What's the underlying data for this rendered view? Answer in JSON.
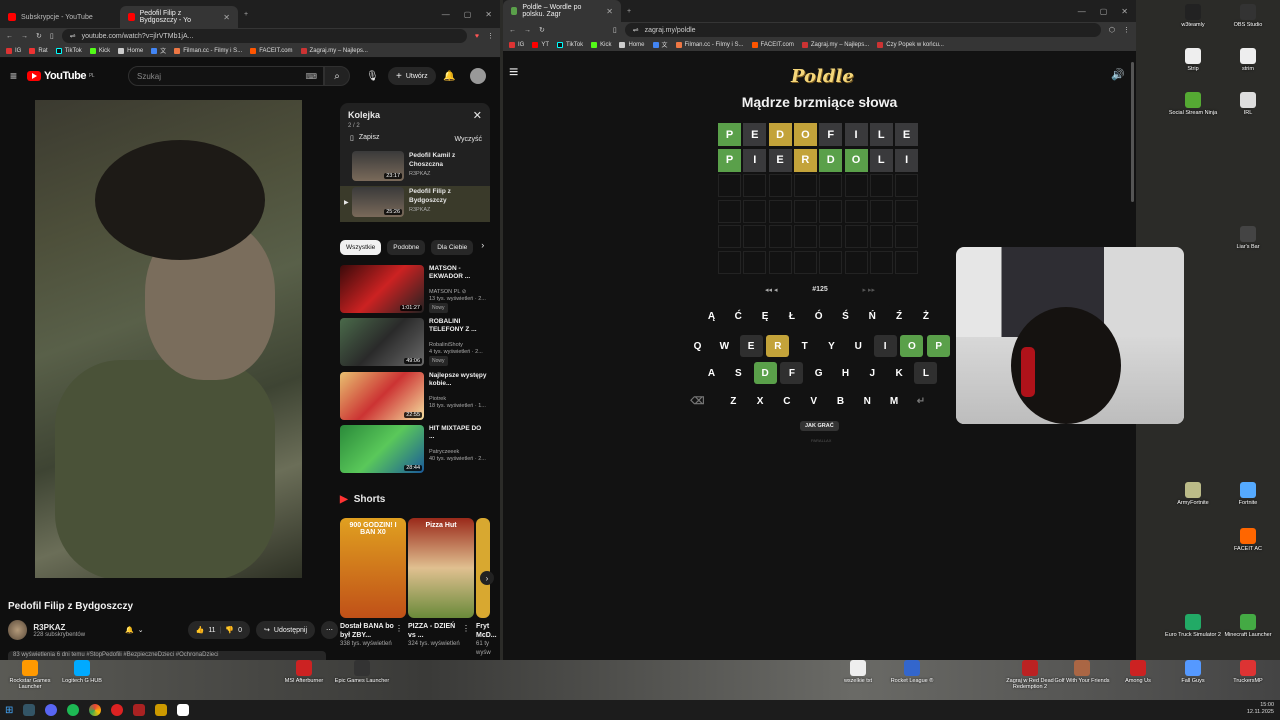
{
  "browser1": {
    "tabs": [
      {
        "label": "Subskrypcje - YouTube"
      },
      {
        "label": "Pedofil Filip z Bydgoszczy - Yo"
      }
    ],
    "url": "youtube.com/watch?v=jlrVTMb1jA...",
    "bookmarks": [
      "IG",
      "Rat",
      "TikTok",
      "Kick",
      "Home",
      "文",
      "Filman.cc - Filmy i S...",
      "FACEIT.com",
      "Zagraj.my – Najleps..."
    ]
  },
  "youtube": {
    "logo": "YouTube",
    "region": "PL",
    "search_placeholder": "Szukaj",
    "create_label": "Utwórz",
    "video_title": "Pedofil Filip z Bydgoszczy",
    "channel": "R3PKAZ",
    "subs": "228 subskrybentów",
    "likes": "11",
    "dislikes": "0",
    "share": "Udostępnij",
    "desc": "83 wyświetlenia  6 dni temu  #StopPedofili #BezpieczneDzieci #OchronaDzieci",
    "queue": {
      "title": "Kolejka",
      "count": "2 / 2",
      "save": "Zapisz",
      "clear": "Wyczyść",
      "items": [
        {
          "title": "Pedofil Kamil z Choszczna",
          "channel": "R3PKAZ",
          "dur": "23:17"
        },
        {
          "title": "Pedofil Filip z Bydgoszczy",
          "channel": "R3PKAZ",
          "dur": "25:26"
        }
      ]
    },
    "chips": [
      "Wszystkie",
      "Podobne",
      "Dla Ciebie"
    ],
    "recs": [
      {
        "t": "MATSON - EKWADOR ...",
        "c": "MATSON PL ⊘",
        "v": "13 tys. wyświetleń · 2...",
        "dur": "1:01:27",
        "badge": "Nowy"
      },
      {
        "t": "ROBALINI TELEFONY Z ...",
        "c": "RobaliniShoty",
        "v": "4 tys. wyświetleń · 2...",
        "dur": "49:06",
        "badge": "Nowy"
      },
      {
        "t": "Najlepsze występy kobie...",
        "c": "Piotrek",
        "v": "18 tys. wyświetleń · 1...",
        "dur": "22:55",
        "badge": ""
      },
      {
        "t": "HIT MIXTAPE DO ...",
        "c": "Patryczeeek",
        "v": "40 tys. wyświetleń · 2...",
        "dur": "28:44",
        "badge": ""
      }
    ],
    "shorts_title": "Shorts",
    "shorts": [
      {
        "t": "Dostał BANA bo był ZBY...",
        "v": "338 tys. wyświetleń",
        "thumb": "900 GODZIN! I BAN X0"
      },
      {
        "t": "PIZZA - DZIEŃ vs ...",
        "v": "324 tys. wyświetleń",
        "thumb": "Pizza Hut"
      },
      {
        "t": "Fryt McD...",
        "v": "61 ty wyśw",
        "thumb": ""
      }
    ]
  },
  "browser2": {
    "tab": "Poldle – Wordle po polsku. Zagr",
    "url": "zagraj.my/poldle",
    "bookmarks": [
      "IG",
      "YT",
      "TikTok",
      "Kick",
      "Home",
      "文",
      "Filman.cc - Filmy i S...",
      "FACEIT.com",
      "Zagraj.my – Najleps...",
      "Czy Popek w końcu..."
    ]
  },
  "poldle": {
    "logo": "Poldle",
    "subtitle": "Mądrze brzmiące słowa",
    "puzzle": "#125",
    "how_to": "JAK GRAĆ",
    "footer": "PARALLAX",
    "rows": [
      [
        {
          "l": "P",
          "s": "g"
        },
        {
          "l": "E",
          "s": "n"
        },
        {
          "l": "D",
          "s": "y"
        },
        {
          "l": "O",
          "s": "y"
        },
        {
          "l": "F",
          "s": "n"
        },
        {
          "l": "I",
          "s": "n"
        },
        {
          "l": "L",
          "s": "n"
        },
        {
          "l": "E",
          "s": "n"
        }
      ],
      [
        {
          "l": "P",
          "s": "g"
        },
        {
          "l": "I",
          "s": "n"
        },
        {
          "l": "E",
          "s": "n"
        },
        {
          "l": "R",
          "s": "y"
        },
        {
          "l": "D",
          "s": "g"
        },
        {
          "l": "O",
          "s": "g"
        },
        {
          "l": "L",
          "s": "n"
        },
        {
          "l": "I",
          "s": "n"
        }
      ]
    ],
    "keys": [
      [
        {
          "k": "Ą",
          "s": ""
        },
        {
          "k": "Ć",
          "s": ""
        },
        {
          "k": "Ę",
          "s": ""
        },
        {
          "k": "Ł",
          "s": ""
        },
        {
          "k": "Ó",
          "s": ""
        },
        {
          "k": "Ś",
          "s": ""
        },
        {
          "k": "Ń",
          "s": ""
        },
        {
          "k": "Ź",
          "s": ""
        },
        {
          "k": "Ż",
          "s": ""
        }
      ],
      [
        {
          "k": "Q",
          "s": ""
        },
        {
          "k": "W",
          "s": ""
        },
        {
          "k": "E",
          "s": "d"
        },
        {
          "k": "R",
          "s": "y"
        },
        {
          "k": "T",
          "s": ""
        },
        {
          "k": "Y",
          "s": ""
        },
        {
          "k": "U",
          "s": ""
        },
        {
          "k": "I",
          "s": "d"
        },
        {
          "k": "O",
          "s": "g"
        },
        {
          "k": "P",
          "s": "g"
        }
      ],
      [
        {
          "k": "A",
          "s": ""
        },
        {
          "k": "S",
          "s": ""
        },
        {
          "k": "D",
          "s": "g"
        },
        {
          "k": "F",
          "s": "d"
        },
        {
          "k": "G",
          "s": ""
        },
        {
          "k": "H",
          "s": ""
        },
        {
          "k": "J",
          "s": ""
        },
        {
          "k": "K",
          "s": ""
        },
        {
          "k": "L",
          "s": "d"
        }
      ],
      [
        {
          "k": "⌫",
          "s": ""
        },
        {
          "k": "Z",
          "s": ""
        },
        {
          "k": "X",
          "s": ""
        },
        {
          "k": "C",
          "s": ""
        },
        {
          "k": "V",
          "s": ""
        },
        {
          "k": "B",
          "s": ""
        },
        {
          "k": "N",
          "s": ""
        },
        {
          "k": "M",
          "s": ""
        },
        {
          "k": "↵",
          "s": ""
        }
      ]
    ]
  },
  "desktop": {
    "right_icons": [
      "OBS Studio",
      "w3teamly",
      "Strip",
      "strim",
      "Social Stream Ninja",
      "IRL",
      "Liar's Bar",
      "ArmyFortnite",
      "Fortnite",
      "FACEIT AC",
      "Euro Truck Simulator 2",
      "Minecraft Launcher",
      "Rocket League ®",
      "Zagraj w Red Dead Redemption 2",
      "Golf With Your Friends",
      "Among Us",
      "Fall Guys",
      "TruckersMP"
    ],
    "bottom_icons": [
      "Rockstar Games Launcher",
      "Logitech G HUB",
      "MSI Afterburner",
      "Epic Games Launcher",
      "wszelkie txt"
    ],
    "time": "15:00",
    "date": "12.11.2025"
  },
  "colors": {
    "correct": "#5aa04a",
    "present": "#c3a33a",
    "absent": "#3a3a3c",
    "yt_red": "#ff0000"
  }
}
